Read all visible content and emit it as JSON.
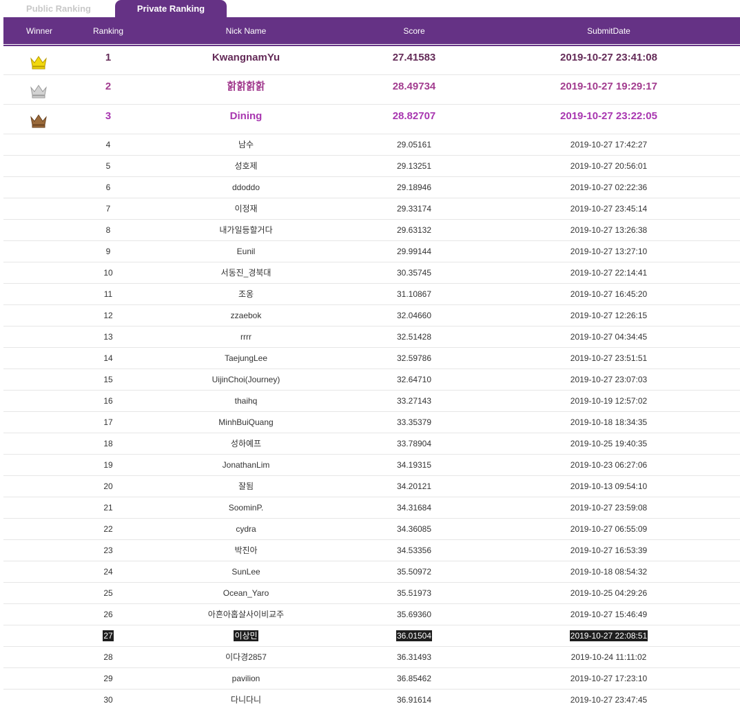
{
  "tabs": {
    "public": "Public Ranking",
    "private": "Private Ranking"
  },
  "columns": {
    "winner": "Winner",
    "ranking": "Ranking",
    "nick": "Nick Name",
    "score": "Score",
    "date": "SubmitDate"
  },
  "colors": {
    "header": "#653285",
    "gold": "#f2d80c",
    "silver": "#d3d3d3",
    "bronze": "#9a6a3a",
    "highlight": "#1e1e1e"
  },
  "icons": {
    "first": "gold-crown-icon",
    "second": "silver-crown-icon",
    "third": "bronze-crown-icon"
  },
  "highlight_rank": "27",
  "rows": [
    {
      "rank": "1",
      "nick": "KwangnamYu",
      "score": "27.41583",
      "date": "2019-10-27 23:41:08"
    },
    {
      "rank": "2",
      "nick": "핡핡핡핡",
      "score": "28.49734",
      "date": "2019-10-27 19:29:17"
    },
    {
      "rank": "3",
      "nick": "Dining",
      "score": "28.82707",
      "date": "2019-10-27 23:22:05"
    },
    {
      "rank": "4",
      "nick": "남수",
      "score": "29.05161",
      "date": "2019-10-27 17:42:27"
    },
    {
      "rank": "5",
      "nick": "성호제",
      "score": "29.13251",
      "date": "2019-10-27 20:56:01"
    },
    {
      "rank": "6",
      "nick": "ddoddo",
      "score": "29.18946",
      "date": "2019-10-27 02:22:36"
    },
    {
      "rank": "7",
      "nick": "이정재",
      "score": "29.33174",
      "date": "2019-10-27 23:45:14"
    },
    {
      "rank": "8",
      "nick": "내가일등할거다",
      "score": "29.63132",
      "date": "2019-10-27 13:26:38"
    },
    {
      "rank": "9",
      "nick": "Eunil",
      "score": "29.99144",
      "date": "2019-10-27 13:27:10"
    },
    {
      "rank": "10",
      "nick": "서동진_경북대",
      "score": "30.35745",
      "date": "2019-10-27 22:14:41"
    },
    {
      "rank": "11",
      "nick": "조옹",
      "score": "31.10867",
      "date": "2019-10-27 16:45:20"
    },
    {
      "rank": "12",
      "nick": "zzaebok",
      "score": "32.04660",
      "date": "2019-10-27 12:26:15"
    },
    {
      "rank": "13",
      "nick": "rrrr",
      "score": "32.51428",
      "date": "2019-10-27 04:34:45"
    },
    {
      "rank": "14",
      "nick": "TaejungLee",
      "score": "32.59786",
      "date": "2019-10-27 23:51:51"
    },
    {
      "rank": "15",
      "nick": "UijinChoi(Journey)",
      "score": "32.64710",
      "date": "2019-10-27 23:07:03"
    },
    {
      "rank": "16",
      "nick": "thaihq",
      "score": "33.27143",
      "date": "2019-10-19 12:57:02"
    },
    {
      "rank": "17",
      "nick": "MinhBuiQuang",
      "score": "33.35379",
      "date": "2019-10-18 18:34:35"
    },
    {
      "rank": "18",
      "nick": "성하예프",
      "score": "33.78904",
      "date": "2019-10-25 19:40:35"
    },
    {
      "rank": "19",
      "nick": "JonathanLim",
      "score": "34.19315",
      "date": "2019-10-23 06:27:06"
    },
    {
      "rank": "20",
      "nick": "잘됨",
      "score": "34.20121",
      "date": "2019-10-13 09:54:10"
    },
    {
      "rank": "21",
      "nick": "SoominP.",
      "score": "34.31684",
      "date": "2019-10-27 23:59:08"
    },
    {
      "rank": "22",
      "nick": "cydra",
      "score": "34.36085",
      "date": "2019-10-27 06:55:09"
    },
    {
      "rank": "23",
      "nick": "박진아",
      "score": "34.53356",
      "date": "2019-10-27 16:53:39"
    },
    {
      "rank": "24",
      "nick": "SunLee",
      "score": "35.50972",
      "date": "2019-10-18 08:54:32"
    },
    {
      "rank": "25",
      "nick": "Ocean_Yaro",
      "score": "35.51973",
      "date": "2019-10-25 04:29:26"
    },
    {
      "rank": "26",
      "nick": "아흔아홉살사이비교주",
      "score": "35.69360",
      "date": "2019-10-27 15:46:49"
    },
    {
      "rank": "27",
      "nick": "이상민",
      "score": "36.01504",
      "date": "2019-10-27 22:08:51"
    },
    {
      "rank": "28",
      "nick": "이다경2857",
      "score": "36.31493",
      "date": "2019-10-24 11:11:02"
    },
    {
      "rank": "29",
      "nick": "pavilion",
      "score": "36.85462",
      "date": "2019-10-27 17:23:10"
    },
    {
      "rank": "30",
      "nick": "다니다니",
      "score": "36.91614",
      "date": "2019-10-27 23:47:45"
    }
  ]
}
